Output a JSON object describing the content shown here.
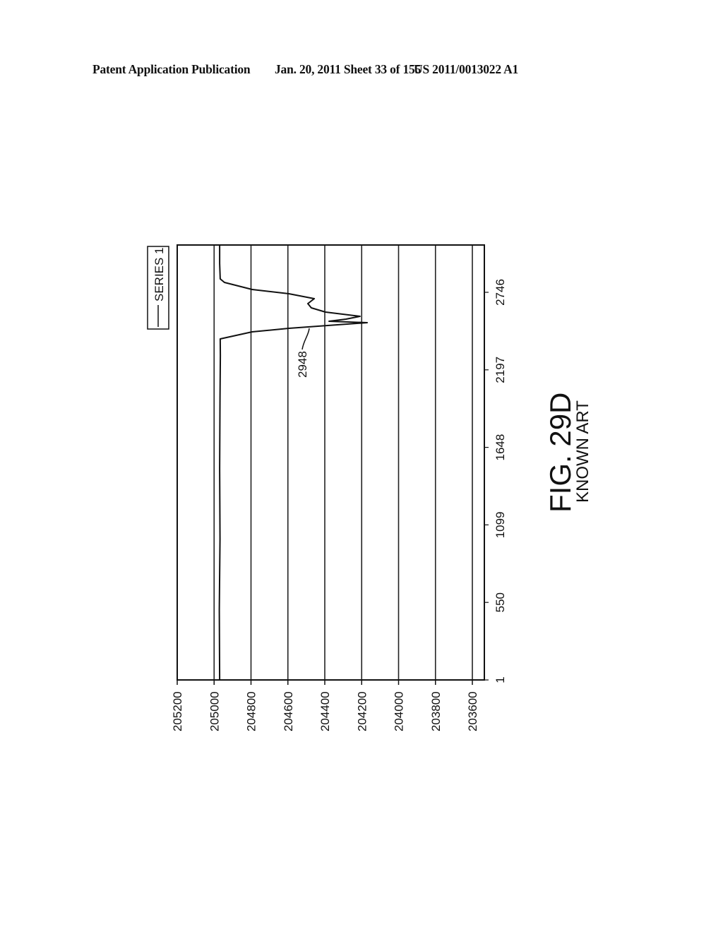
{
  "header": {
    "publication": "Patent Application Publication",
    "date_sheet": "Jan. 20, 2011   Sheet 33 of 155",
    "patent_number": "US 2011/0013022 A1"
  },
  "figure": {
    "title": "FIG. 29D",
    "subtitle": "KNOWN ART",
    "reference_label": "2948",
    "orientation": "rotated 90 degrees counter-clockwise"
  },
  "chart_data": {
    "type": "line",
    "title": "",
    "xlabel": "",
    "ylabel": "",
    "legend": {
      "entries": [
        "SERIES 1"
      ],
      "placement": "top-right (rotated)"
    },
    "grid": true,
    "x_ticks": [
      "1",
      "550",
      "1099",
      "1648",
      "2197",
      "2746"
    ],
    "x_tick_values": [
      1,
      550,
      1099,
      1648,
      2197,
      2746
    ],
    "xlim": [
      1,
      3081
    ],
    "y_ticks": [
      "205200",
      "205000",
      "204800",
      "204600",
      "204400",
      "204200",
      "204000",
      "203800",
      "203600"
    ],
    "y_tick_values": [
      205200,
      205000,
      204800,
      204600,
      204400,
      204200,
      204000,
      203800,
      203600
    ],
    "ylim": [
      203560,
      205200
    ],
    "series": [
      {
        "name": "SERIES 1",
        "x": [
          1,
          500,
          1000,
          1500,
          2000,
          2300,
          2416,
          2466,
          2491,
          2531,
          2541,
          2556,
          2576,
          2606,
          2636,
          2666,
          2701,
          2736,
          2766,
          2816,
          2841,
          2950,
          3081
        ],
        "values": [
          204970,
          204972,
          204968,
          204970,
          204968,
          204966,
          204967,
          204794,
          204595,
          204170,
          204377,
          204285,
          204209,
          204396,
          204473,
          204492,
          204457,
          204595,
          204794,
          204944,
          204967,
          204970,
          204970
        ]
      }
    ],
    "annotations": [
      {
        "text": "2948",
        "points_to": "descending edge of the dip near x≈2490"
      }
    ]
  }
}
